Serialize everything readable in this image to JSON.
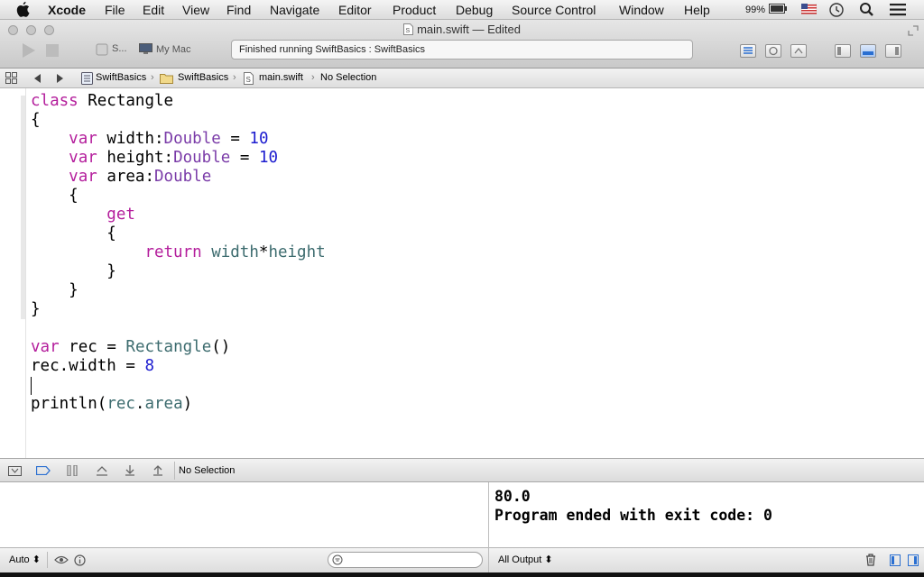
{
  "menubar": {
    "app_name": "Xcode",
    "items": [
      "File",
      "Edit",
      "View",
      "Find",
      "Navigate",
      "Editor",
      "Product",
      "Debug",
      "Source Control",
      "Window",
      "Help"
    ],
    "battery": "99%"
  },
  "toolbar": {
    "window_title": "main.swift — Edited",
    "scheme": "S...",
    "destination": "My Mac",
    "activity_status": "Finished running SwiftBasics : SwiftBasics"
  },
  "jumpbar": {
    "project": "SwiftBasics",
    "group": "SwiftBasics",
    "file": "main.swift",
    "selection": "No Selection"
  },
  "editor": {
    "lines": [
      "class Rectangle",
      "{",
      "    var width:Double = 10",
      "    var height:Double = 10",
      "    var area:Double",
      "    {",
      "        get",
      "        {",
      "            return width*height",
      "        }",
      "    }",
      "}",
      "",
      "var rec = Rectangle()",
      "rec.width = 8",
      "",
      "println(rec.area)"
    ]
  },
  "debug_bar": {
    "selection": "No Selection"
  },
  "variables_view": {
    "scope": "Auto"
  },
  "console": {
    "output_lines": [
      "80.0",
      "Program ended with exit code: 0"
    ],
    "filter": "All Output"
  },
  "colors": {
    "keyword": "#b41e9c",
    "type": "#7a3ba8",
    "number": "#1c1ccf",
    "identifier": "#3c6b6e"
  }
}
